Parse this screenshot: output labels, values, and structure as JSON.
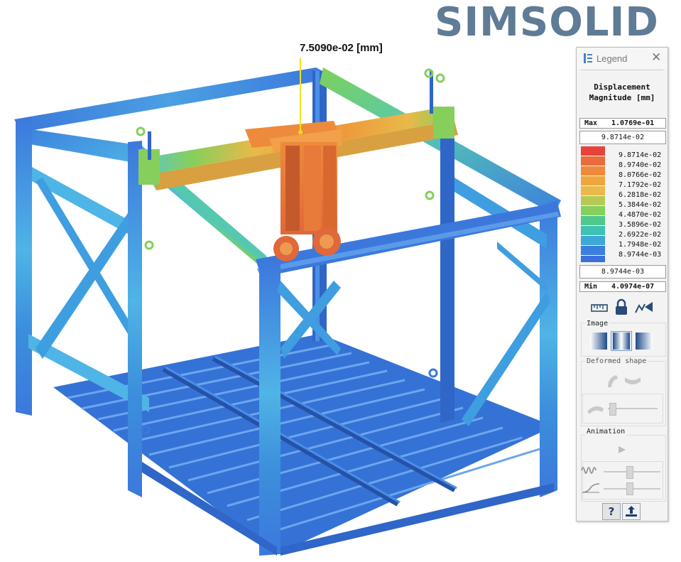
{
  "brand": {
    "logo_text": "SIMSOLID"
  },
  "viewport": {
    "probe_label": "7.5090e-02 [mm]"
  },
  "legend": {
    "title": "Legend",
    "heading_line1": "Displacement",
    "heading_line2": "Magnitude [mm]",
    "max_label": "Max",
    "max_value": "1.0769e-01",
    "upper_bound": "9.8714e-02",
    "scale": [
      {
        "label": "9.8714e-02",
        "color": "#e8433a"
      },
      {
        "label": "8.9740e-02",
        "color": "#ec6b3a"
      },
      {
        "label": "8.0766e-02",
        "color": "#ee8a3c"
      },
      {
        "label": "7.1792e-02",
        "color": "#f0a53e"
      },
      {
        "label": "6.2818e-02",
        "color": "#e9b94a"
      },
      {
        "label": "5.3844e-02",
        "color": "#b7c955"
      },
      {
        "label": "4.4870e-02",
        "color": "#86cf5c"
      },
      {
        "label": "3.5896e-02",
        "color": "#4ec98a"
      },
      {
        "label": "2.6922e-02",
        "color": "#3fc2b2"
      },
      {
        "label": "1.7948e-02",
        "color": "#3ea8d6"
      },
      {
        "label": "8.9744e-03",
        "color": "#3b7fe0"
      }
    ],
    "lower_bound": "8.9744e-03",
    "min_label": "Min",
    "min_value": "4.0974e-07",
    "image_group_label": "Image",
    "deformed_group_label": "Deformed shape",
    "animation_group_label": "Animation",
    "help_glyph": "?"
  },
  "colors": {
    "frame_blue": "#3c78dc",
    "frame_dark": "#2a5bb8",
    "frame_cyan": "#4fb4e6",
    "frame_teal": "#48c6b8",
    "frame_green": "#7ed15a",
    "beam_orange": "#ee8a3c",
    "beam_yellow": "#e9b94a",
    "logo": "#5f7b96"
  }
}
